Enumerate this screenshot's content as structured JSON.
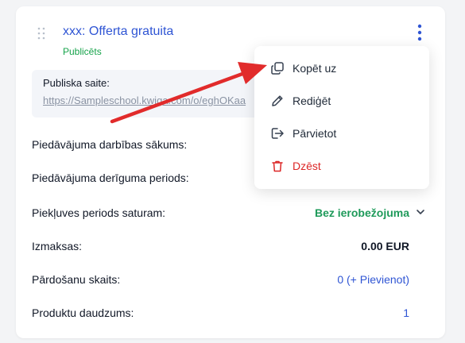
{
  "offer": {
    "title": "xxx: Offerta gratuita",
    "status": "Publicēts",
    "status_color": "#16a34a"
  },
  "public_link": {
    "label": "Publiska saite:",
    "url": "https://Sampleschool.kwiga.com/o/eghOKaa"
  },
  "rows": [
    {
      "label": "Piedāvājuma darbības sākums:"
    },
    {
      "label": "Piedāvājuma derīguma periods:"
    },
    {
      "label": "Piekļuves periods saturam:",
      "value": "Bez ierobežojuma"
    },
    {
      "label": "Izmaksas:",
      "value": "0.00 EUR"
    },
    {
      "label": "Pārdošanu skaits:",
      "count": "0",
      "add": "(+ Pievienot)"
    },
    {
      "label": "Produktu daudzums:",
      "value": "1"
    }
  ],
  "menu": {
    "items": [
      {
        "label": "Kopēt uz",
        "icon": "copy-icon"
      },
      {
        "label": "Rediģēt",
        "icon": "pencil-icon"
      },
      {
        "label": "Pārvietot",
        "icon": "move-icon"
      },
      {
        "label": "Dzēst",
        "icon": "trash-icon",
        "color": "#dc2626"
      }
    ]
  },
  "colors": {
    "accent": "#2f55d4",
    "success": "#1e9a5a",
    "danger": "#dc2626",
    "annotation_arrow": "#e12b2b"
  }
}
